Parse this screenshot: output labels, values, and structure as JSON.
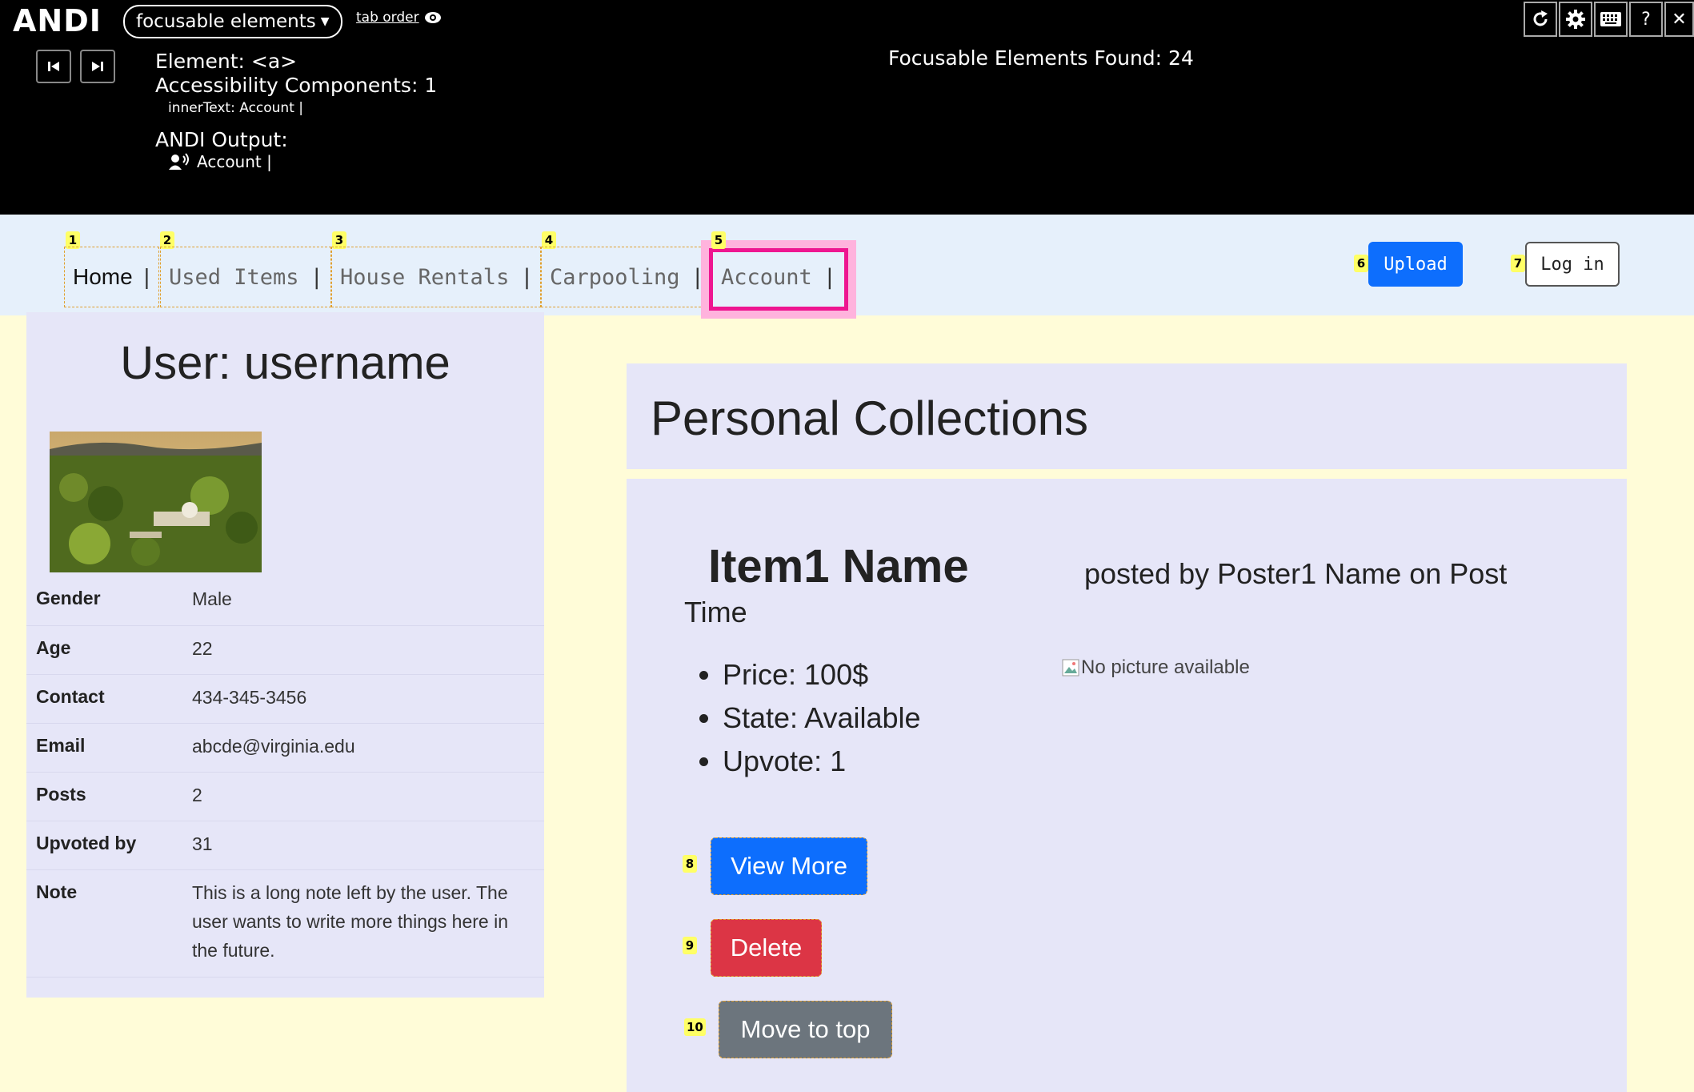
{
  "andi": {
    "logo": "ANDI",
    "module": "focusable elements",
    "tab_order": "tab order",
    "element_line": "Element: <a>",
    "components_line": "Accessibility Components: 1",
    "inner_text_line": "innerText: Account |",
    "output_label": "ANDI Output:",
    "output_text": "Account |",
    "found": "Focusable Elements Found: 24",
    "tools": [
      "refresh-icon",
      "settings-icon",
      "keyboard-icon",
      "help-icon",
      "close-icon"
    ],
    "help_glyph": "?",
    "close_glyph": "✕",
    "highlight_color": "#ee1690"
  },
  "nav": {
    "links": [
      {
        "badge": "1",
        "label": "Home",
        "sep": "|"
      },
      {
        "badge": "2",
        "label": "Used Items",
        "sep": "|"
      },
      {
        "badge": "3",
        "label": "House Rentals",
        "sep": "|"
      },
      {
        "badge": "4",
        "label": "Carpooling",
        "sep": "|"
      },
      {
        "badge": "5",
        "label": "Account",
        "sep": "|"
      }
    ],
    "upload_badge": "6",
    "upload_label": "Upload",
    "login_badge": "7",
    "login_label": "Log in"
  },
  "profile": {
    "title": "User: username",
    "photo_alt": "campus aerial photo",
    "rows": [
      {
        "key": "Gender",
        "value": "Male"
      },
      {
        "key": "Age",
        "value": "22"
      },
      {
        "key": "Contact",
        "value": "434-345-3456"
      },
      {
        "key": "Email",
        "value": "abcde@virginia.edu"
      },
      {
        "key": "Posts",
        "value": "2"
      },
      {
        "key": "Upvoted by",
        "value": "31"
      },
      {
        "key": "Note",
        "value": "This is a long note left by the user. The user wants to write more things here in the future."
      }
    ]
  },
  "collections": {
    "title": "Personal Collections",
    "item": {
      "name": "Item1 Name",
      "posted_by": "posted by Poster1 Name on Post",
      "time": "Time",
      "props": [
        "Price: 100$",
        "State: Available",
        "Upvote: 1"
      ],
      "no_picture": "No picture available",
      "view_more_badge": "8",
      "view_more": "View More",
      "delete_badge": "9",
      "delete": "Delete",
      "move_top_badge": "10",
      "move_top": "Move to top"
    }
  },
  "colors": {
    "primary": "#0d6efd",
    "danger": "#dc3545",
    "secondary": "#6c757d",
    "nav_bg": "#e6f0fb",
    "page_bg": "#fffcd8",
    "card_bg": "#e6e6f8"
  }
}
